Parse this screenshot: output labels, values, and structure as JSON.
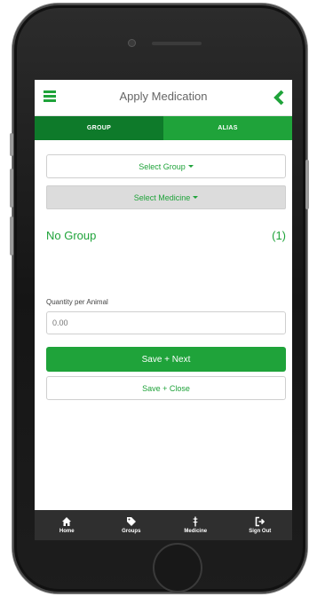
{
  "header": {
    "title": "Apply Medication"
  },
  "tabs": [
    {
      "label": "GROUP",
      "active": true
    },
    {
      "label": "ALIAS",
      "active": false
    }
  ],
  "selects": {
    "group_label": "Select Group",
    "medicine_label": "Select Medicine"
  },
  "group": {
    "name": "No Group",
    "count": "(1)"
  },
  "quantity": {
    "label": "Quantity per Animal",
    "placeholder": "0.00"
  },
  "buttons": {
    "save_next": "Save + Next",
    "save_close": "Save + Close"
  },
  "nav": [
    {
      "label": "Home",
      "icon": "home-icon"
    },
    {
      "label": "Groups",
      "icon": "tag-icon"
    },
    {
      "label": "Medicine",
      "icon": "medicine-icon"
    },
    {
      "label": "Sign Out",
      "icon": "sign-out-icon"
    }
  ],
  "colors": {
    "accent": "#1fa33a",
    "accent_dark": "#0e7a2a",
    "nav_bg": "#2f2f2f"
  }
}
